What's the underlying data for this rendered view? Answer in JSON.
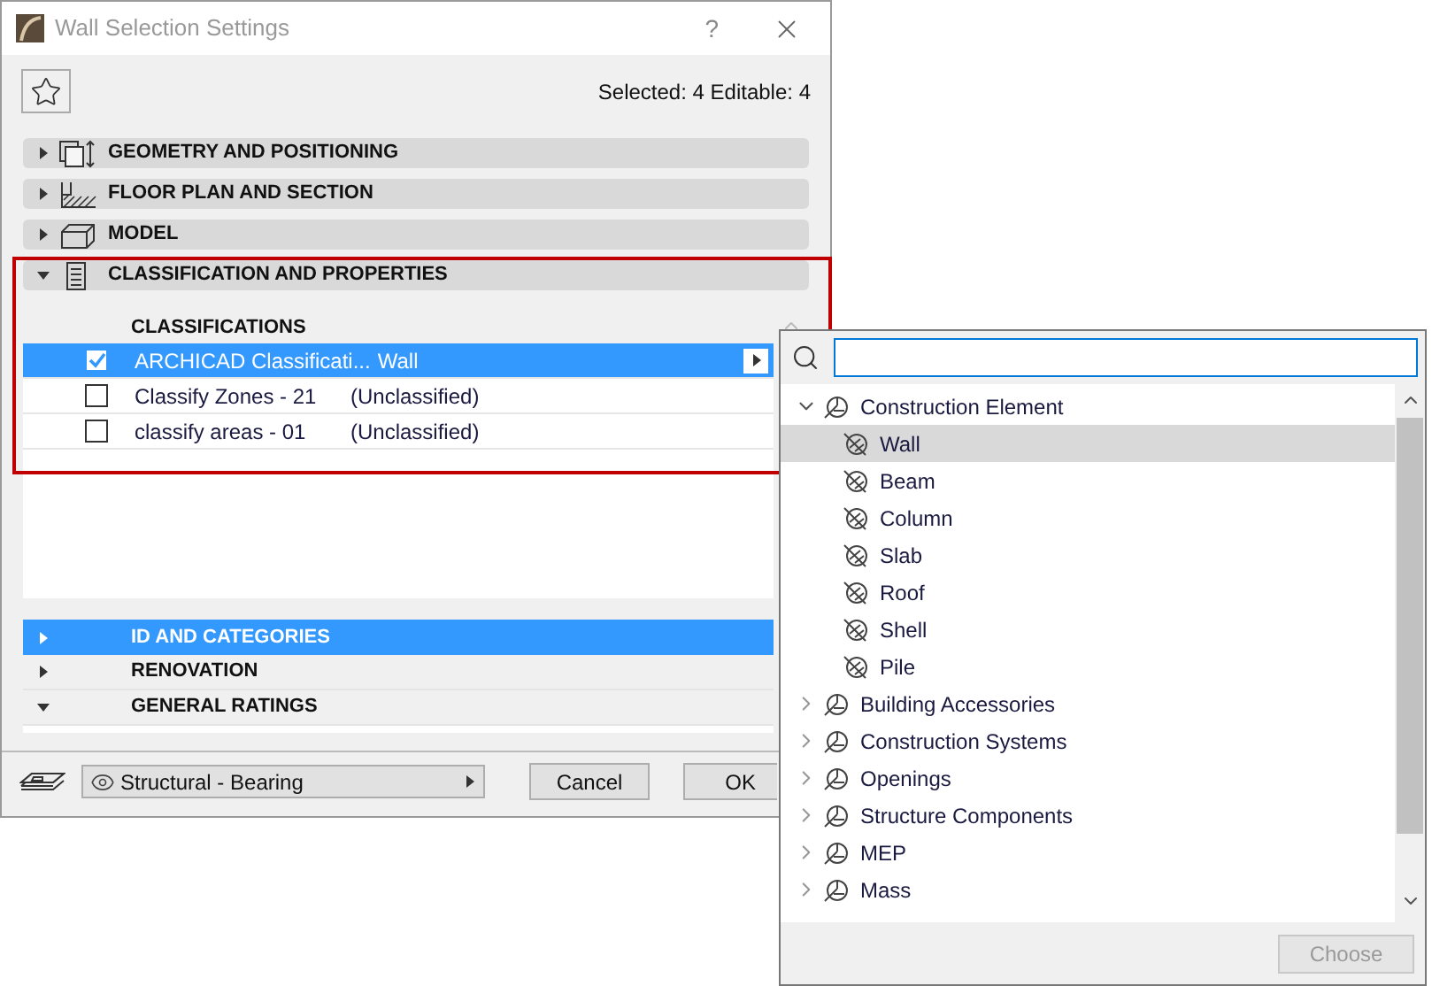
{
  "window": {
    "title": "Wall Selection Settings",
    "help": "?"
  },
  "selection_info": "Selected: 4 Editable: 4",
  "panels": [
    {
      "label": "GEOMETRY AND POSITIONING",
      "expanded": false
    },
    {
      "label": "FLOOR PLAN AND SECTION",
      "expanded": false
    },
    {
      "label": "MODEL",
      "expanded": false
    },
    {
      "label": "CLASSIFICATION AND PROPERTIES",
      "expanded": true
    }
  ],
  "classifications": {
    "header": "CLASSIFICATIONS",
    "rows": [
      {
        "name": "ARCHICAD Classificati...",
        "value": "Wall",
        "checked": true,
        "selected": true
      },
      {
        "name": "Classify Zones - 21",
        "value": "(Unclassified)",
        "checked": false,
        "selected": false
      },
      {
        "name": "classify areas - 01",
        "value": "(Unclassified)",
        "checked": false,
        "selected": false
      }
    ]
  },
  "property_groups": [
    {
      "label": "ID AND CATEGORIES",
      "expanded": false,
      "selected": true
    },
    {
      "label": "RENOVATION",
      "expanded": false,
      "selected": false
    },
    {
      "label": "GENERAL RATINGS",
      "expanded": true,
      "selected": false
    }
  ],
  "footer": {
    "layer": "Structural - Bearing",
    "buttons": [
      "Cancel",
      "OK"
    ]
  },
  "classification_picker": {
    "tree": [
      {
        "label": "Construction Element",
        "expanded": true,
        "children": [
          {
            "label": "Wall",
            "selected": true
          },
          {
            "label": "Beam",
            "selected": false
          },
          {
            "label": "Column",
            "selected": false
          },
          {
            "label": "Slab",
            "selected": false
          },
          {
            "label": "Roof",
            "selected": false
          },
          {
            "label": "Shell",
            "selected": false
          },
          {
            "label": "Pile",
            "selected": false
          }
        ]
      },
      {
        "label": "Building Accessories",
        "expanded": false
      },
      {
        "label": "Construction Systems",
        "expanded": false
      },
      {
        "label": "Openings",
        "expanded": false
      },
      {
        "label": "Structure Components",
        "expanded": false
      },
      {
        "label": "MEP",
        "expanded": false
      },
      {
        "label": "Mass",
        "expanded": false
      }
    ],
    "choose": {
      "label": "Choose",
      "disabled": true
    }
  }
}
